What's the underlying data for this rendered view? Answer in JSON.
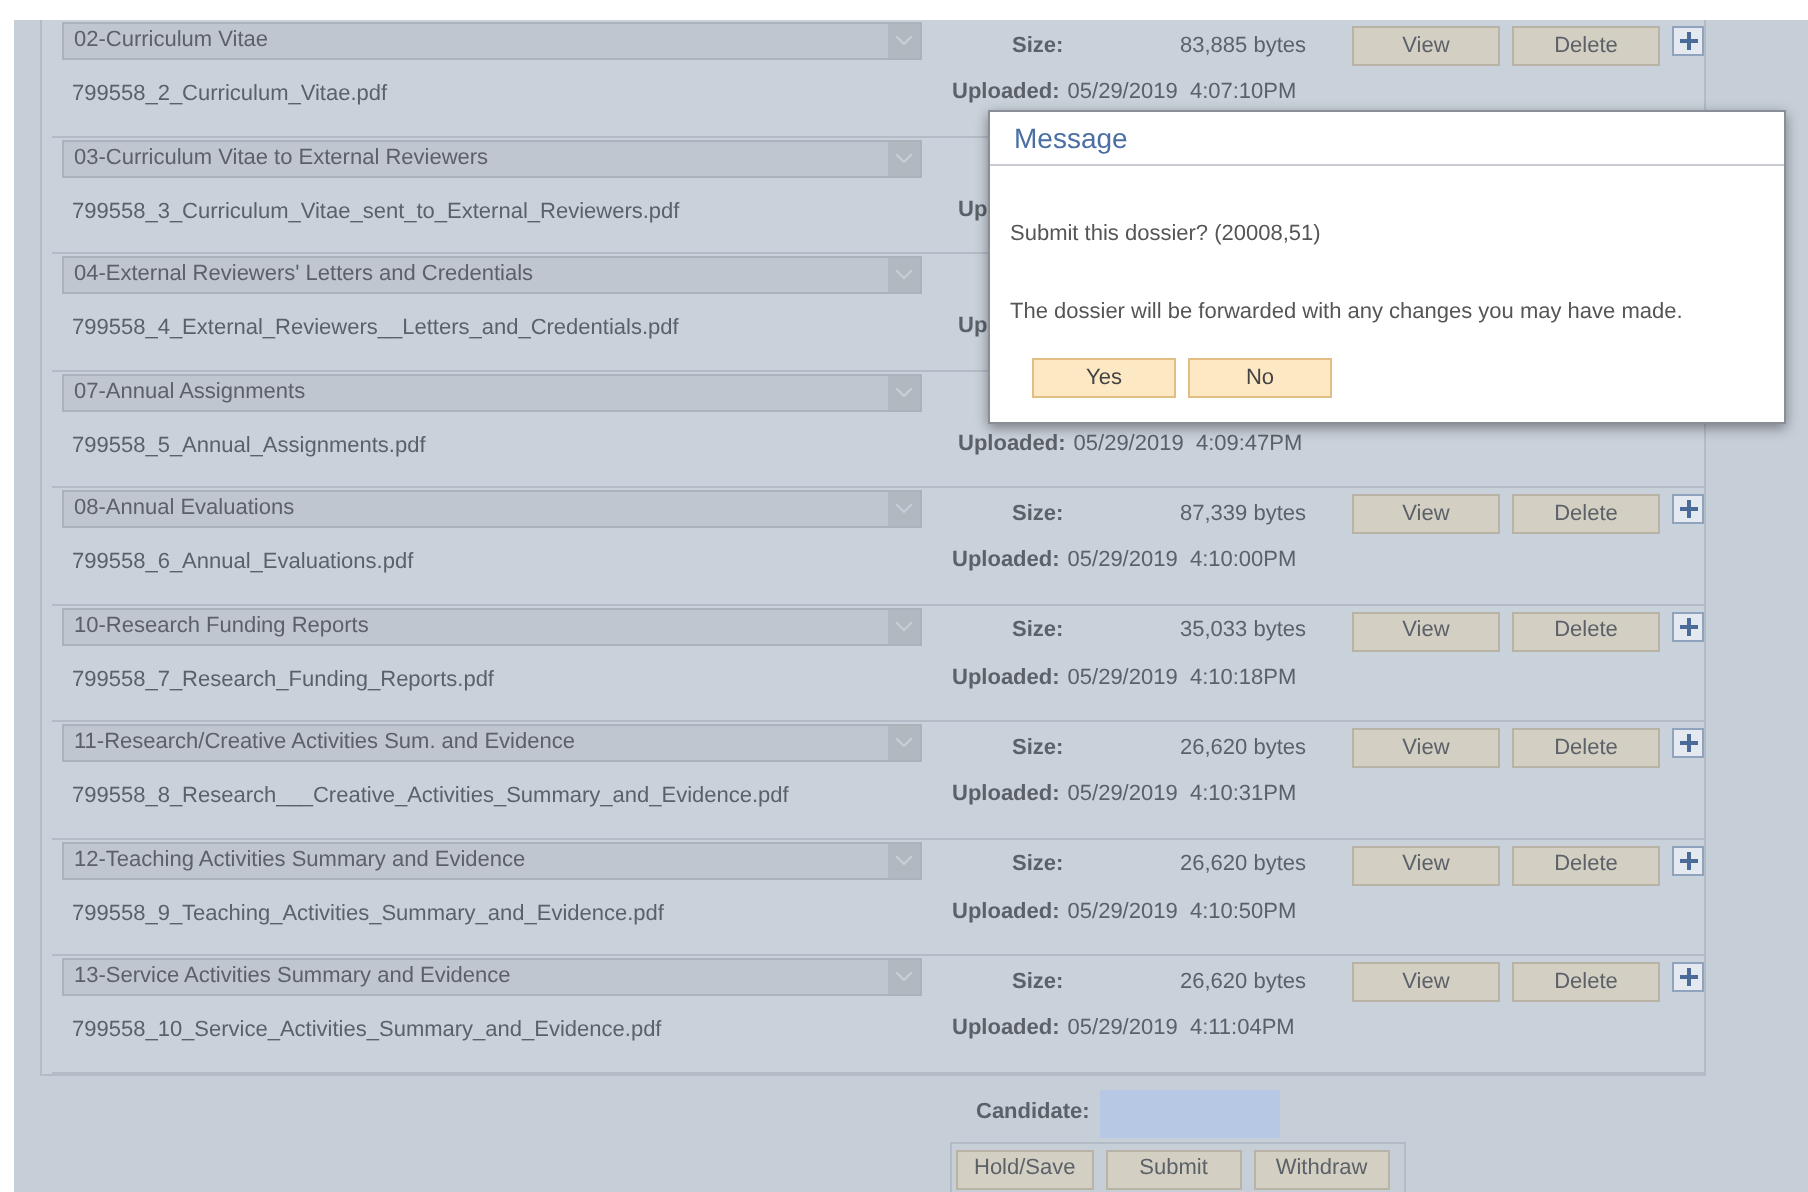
{
  "documents": [
    {
      "category": "02-Curriculum Vitae",
      "filename": "799558_2_Curriculum_Vitae.pdf",
      "size": {
        "label": "Size:",
        "value": "83,885 bytes"
      },
      "actions": [
        "View",
        "Delete"
      ],
      "uploaded": {
        "label": "Uploaded:",
        "date": "05/29/2019  4:07:10PM"
      }
    },
    {
      "category": "03-Curriculum Vitae to External Reviewers",
      "filename": "799558_3_Curriculum_Vitae_sent_to_External_Reviewers.pdf",
      "uploaded": {
        "label": "Up"
      }
    },
    {
      "category": "04-External Reviewers' Letters and Credentials",
      "filename": "799558_4_External_Reviewers__Letters_and_Credentials.pdf",
      "uploaded": {
        "label": "Up"
      }
    },
    {
      "category": "07-Annual Assignments",
      "filename": "799558_5_Annual_Assignments.pdf",
      "uploaded": {
        "label": "Uploaded:",
        "date": "05/29/2019  4:09:47PM"
      }
    },
    {
      "category": "08-Annual Evaluations",
      "filename": "799558_6_Annual_Evaluations.pdf",
      "size": {
        "label": "Size:",
        "value": "87,339 bytes"
      },
      "actions": [
        "View",
        "Delete"
      ],
      "uploaded": {
        "label": "Uploaded:",
        "date": "05/29/2019  4:10:00PM"
      }
    },
    {
      "category": "10-Research Funding Reports",
      "filename": "799558_7_Research_Funding_Reports.pdf",
      "size": {
        "label": "Size:",
        "value": "35,033 bytes"
      },
      "actions": [
        "View",
        "Delete"
      ],
      "uploaded": {
        "label": "Uploaded:",
        "date": "05/29/2019  4:10:18PM"
      }
    },
    {
      "category": "11-Research/Creative Activities Sum. and Evidence",
      "filename": "799558_8_Research___Creative_Activities_Summary_and_Evidence.pdf",
      "size": {
        "label": "Size:",
        "value": "26,620 bytes"
      },
      "actions": [
        "View",
        "Delete"
      ],
      "uploaded": {
        "label": "Uploaded:",
        "date": "05/29/2019  4:10:31PM"
      }
    },
    {
      "category": "12-Teaching Activities Summary and Evidence",
      "filename": "799558_9_Teaching_Activities_Summary_and_Evidence.pdf",
      "size": {
        "label": "Size:",
        "value": "26,620 bytes"
      },
      "actions": [
        "View",
        "Delete"
      ],
      "uploaded": {
        "label": "Uploaded:",
        "date": "05/29/2019  4:10:50PM"
      }
    },
    {
      "category": "13-Service Activities Summary and Evidence",
      "filename": "799558_10_Service_Activities_Summary_and_Evidence.pdf",
      "size": {
        "label": "Size:",
        "value": "26,620 bytes"
      },
      "actions": [
        "View",
        "Delete"
      ],
      "uploaded": {
        "label": "Uploaded:",
        "date": "05/29/2019  4:11:04PM"
      }
    }
  ],
  "candidate": {
    "label": "Candidate:"
  },
  "footer_buttons": [
    "Hold/Save",
    "Submit",
    "Withdraw"
  ],
  "dialog": {
    "title": "Message",
    "question": "Submit this dossier? (20008,51)",
    "text": "The dossier will be forwarded with any changes you may have made.",
    "buttons": [
      "Yes",
      "No"
    ]
  }
}
